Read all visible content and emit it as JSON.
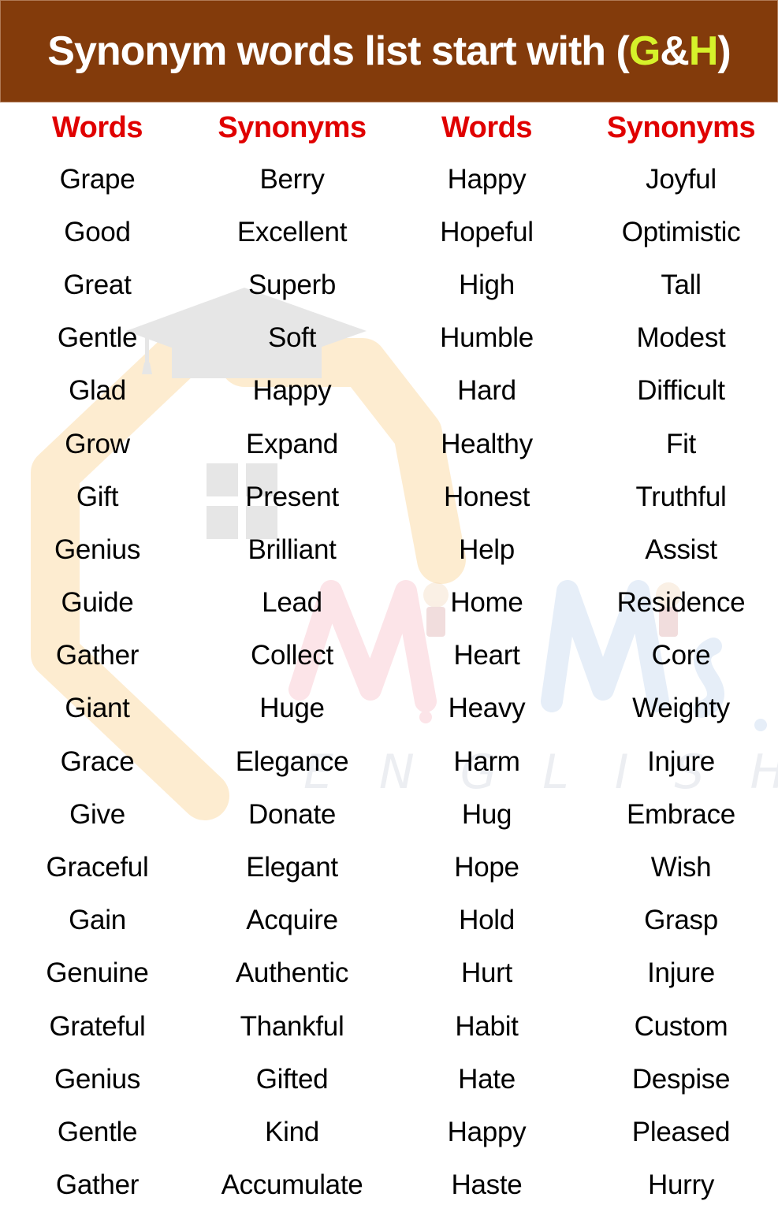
{
  "header": {
    "title_prefix": "Synonym words list start with (",
    "title_g": "G",
    "title_amp": "&",
    "title_h": "H",
    "title_suffix": ")",
    "bg_color": "#833b0b",
    "highlight_color": "#d6f22a"
  },
  "table": {
    "columns": [
      "Words",
      "Synonyms",
      "Words",
      "Synonyms"
    ],
    "header_color": "#e00000",
    "rows": [
      [
        "Grape",
        "Berry",
        "Happy",
        "Joyful"
      ],
      [
        "Good",
        "Excellent",
        "Hopeful",
        "Optimistic"
      ],
      [
        "Great",
        "Superb",
        "High",
        "Tall"
      ],
      [
        "Gentle",
        "Soft",
        "Humble",
        "Modest"
      ],
      [
        "Glad",
        "Happy",
        "Hard",
        "Difficult"
      ],
      [
        "Grow",
        "Expand",
        "Healthy",
        "Fit"
      ],
      [
        "Gift",
        "Present",
        "Honest",
        "Truthful"
      ],
      [
        "Genius",
        "Brilliant",
        "Help",
        "Assist"
      ],
      [
        "Guide",
        "Lead",
        "Home",
        "Residence"
      ],
      [
        "Gather",
        "Collect",
        "Heart",
        "Core"
      ],
      [
        "Giant",
        "Huge",
        "Heavy",
        "Weighty"
      ],
      [
        "Grace",
        "Elegance",
        "Harm",
        "Injure"
      ],
      [
        "Give",
        "Donate",
        "Hug",
        "Embrace"
      ],
      [
        "Graceful",
        "Elegant",
        "Hope",
        "Wish"
      ],
      [
        "Gain",
        "Acquire",
        "Hold",
        "Grasp"
      ],
      [
        "Genuine",
        "Authentic",
        "Hurt",
        "Injure"
      ],
      [
        "Grateful",
        "Thankful",
        "Habit",
        "Custom"
      ],
      [
        "Genius",
        "Gifted",
        "Hate",
        "Despise"
      ],
      [
        "Gentle",
        "Kind",
        "Happy",
        "Pleased"
      ],
      [
        "Gather",
        "Accumulate",
        "Haste",
        "Hurry"
      ]
    ]
  },
  "watermark": {
    "brand_main": "Mr.Mrs.",
    "brand_sub": "ENGLISH",
    "icons": [
      "graduation-cap-icon",
      "house-outline-icon",
      "window-icon",
      "children-icon"
    ]
  }
}
